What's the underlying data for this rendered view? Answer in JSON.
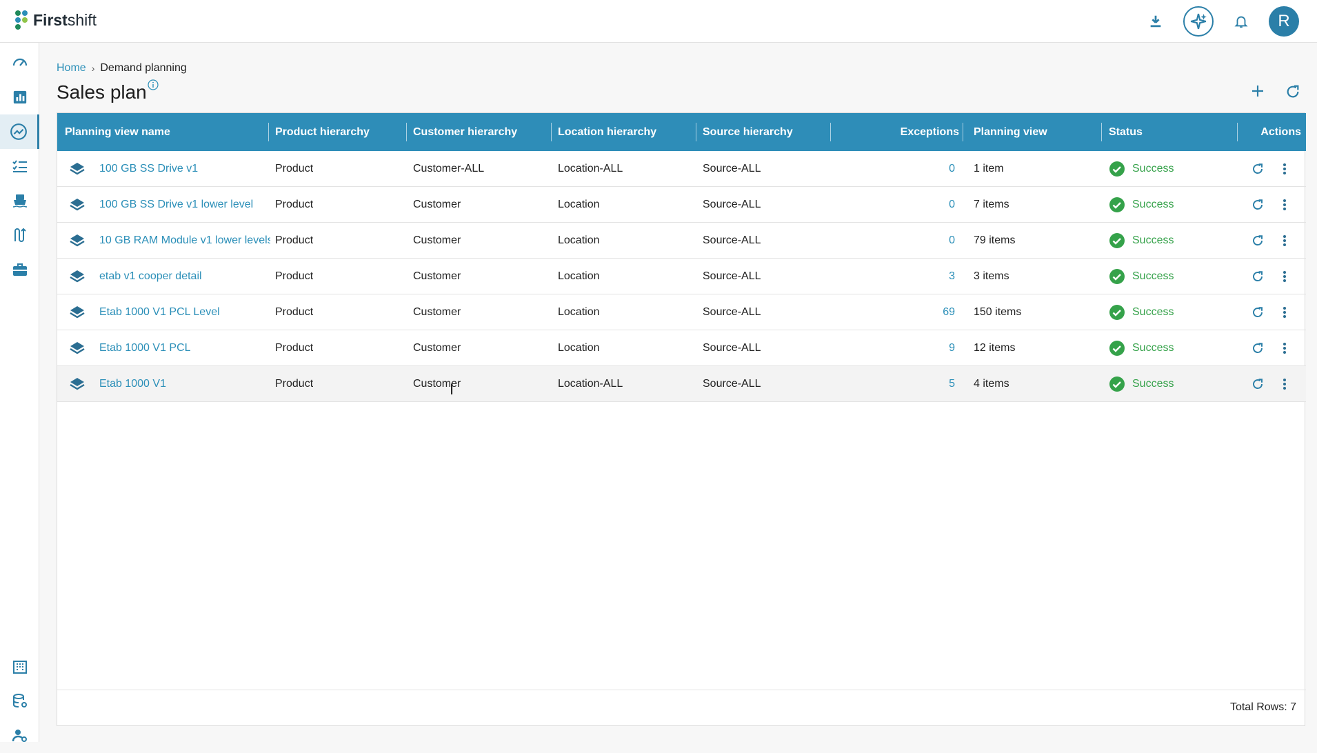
{
  "app": {
    "brand_bold": "First",
    "brand_light": "shift"
  },
  "topbar": {
    "icons": [
      "download-icon",
      "ai-sparkle-icon",
      "bell-icon"
    ],
    "avatar_letter": "R"
  },
  "sidebar": {
    "items": [
      "dashboard-icon",
      "analytics-icon",
      "demand-planning-icon",
      "task-list-icon",
      "shipping-icon",
      "flow-icon",
      "briefcase-icon",
      "building-icon",
      "database-settings-icon",
      "user-settings-icon"
    ],
    "active": "demand-planning-icon"
  },
  "breadcrumb": {
    "home": "Home",
    "separator": "›",
    "current": "Demand planning"
  },
  "page": {
    "title": "Sales plan"
  },
  "table": {
    "columns": [
      "Planning view name",
      "Product hierarchy",
      "Customer hierarchy",
      "Location hierarchy",
      "Source hierarchy",
      "Exceptions",
      "Planning view",
      "Status",
      "Actions"
    ],
    "rows": [
      {
        "name": "100 GB SS Drive v1",
        "product": "Product",
        "customer": "Customer-ALL",
        "location": "Location-ALL",
        "source": "Source-ALL",
        "exceptions": "0",
        "view": "1 item",
        "status": "Success"
      },
      {
        "name": "100 GB SS Drive v1 lower level",
        "product": "Product",
        "customer": "Customer",
        "location": "Location",
        "source": "Source-ALL",
        "exceptions": "0",
        "view": "7 items",
        "status": "Success"
      },
      {
        "name": "10 GB RAM Module v1 lower levels",
        "product": "Product",
        "customer": "Customer",
        "location": "Location",
        "source": "Source-ALL",
        "exceptions": "0",
        "view": "79 items",
        "status": "Success"
      },
      {
        "name": "etab v1 cooper detail",
        "product": "Product",
        "customer": "Customer",
        "location": "Location",
        "source": "Source-ALL",
        "exceptions": "3",
        "view": "3 items",
        "status": "Success"
      },
      {
        "name": "Etab 1000 V1 PCL Level",
        "product": "Product",
        "customer": "Customer",
        "location": "Location",
        "source": "Source-ALL",
        "exceptions": "69",
        "view": "150 items",
        "status": "Success"
      },
      {
        "name": "Etab 1000 V1 PCL",
        "product": "Product",
        "customer": "Customer",
        "location": "Location",
        "source": "Source-ALL",
        "exceptions": "9",
        "view": "12 items",
        "status": "Success"
      },
      {
        "name": "Etab 1000 V1",
        "product": "Product",
        "customer": "Customer",
        "location": "Location-ALL",
        "source": "Source-ALL",
        "exceptions": "5",
        "view": "4 items",
        "status": "Success"
      }
    ],
    "total_rows": "Total Rows: 7"
  },
  "colors": {
    "accent": "#2e8db8",
    "success": "#35a24a"
  }
}
